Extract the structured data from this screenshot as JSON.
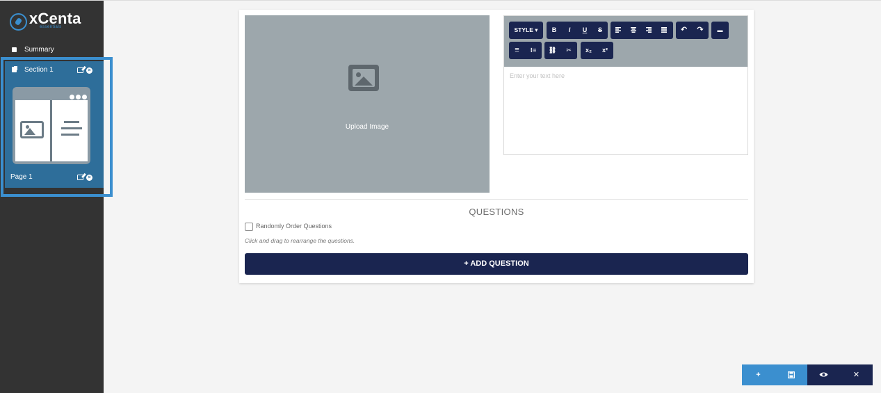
{
  "app": {
    "logo_text": "xCenta",
    "logo_sub": "essentials"
  },
  "sidebar": {
    "summary_label": "Summary",
    "section": {
      "label": "Section 1",
      "page_label": "Page 1"
    }
  },
  "upload": {
    "label": "Upload Image"
  },
  "editor": {
    "style_label": "STYLE ▾",
    "bold": "B",
    "italic": "I",
    "underline": "U",
    "strike": "S",
    "undo": "↶",
    "redo": "↷",
    "hr": "▬",
    "ul": "≡",
    "ol": "⁝≡",
    "link": "⛓",
    "unlink": "✂",
    "subscript": "x₂",
    "superscript": "x²",
    "placeholder": "Enter your text here"
  },
  "questions": {
    "title": "QUESTIONS",
    "random_order_label": "Randomly Order Questions",
    "hint": "Click and drag to rearrange the questions.",
    "add_label": "+ ADD QUESTION"
  },
  "actions": {
    "add": "+",
    "save": "🖫",
    "preview": "👁",
    "close": "✕"
  },
  "colors": {
    "sidebar_bg": "#333333",
    "accent_blue": "#3b8fcf",
    "navy": "#1a2550",
    "placeholder_gray": "#9da7ac"
  }
}
